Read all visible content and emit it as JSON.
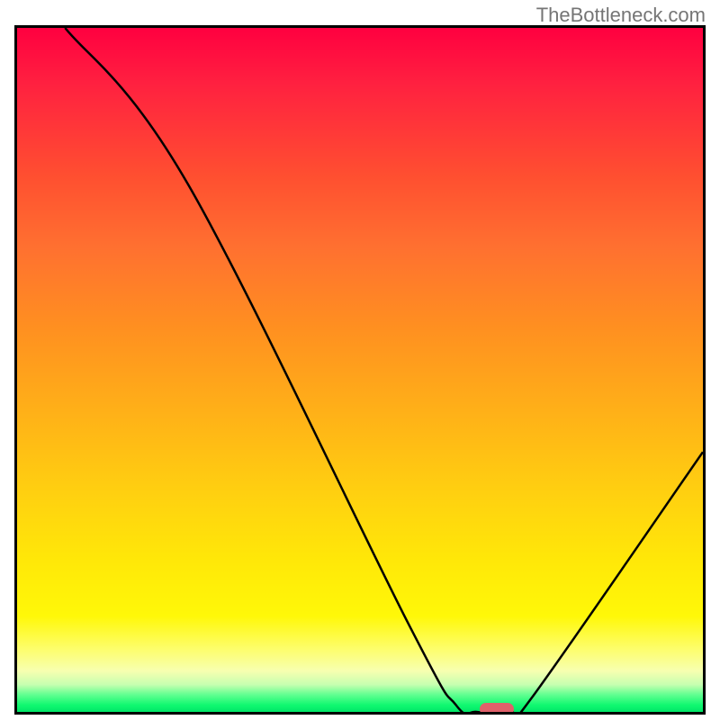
{
  "watermark": "TheBottleneck.com",
  "chart_data": {
    "type": "line",
    "title": "",
    "xlabel": "",
    "ylabel": "",
    "xlim": [
      0,
      100
    ],
    "ylim": [
      0,
      100
    ],
    "curve": [
      {
        "x": 7,
        "y": 100
      },
      {
        "x": 25,
        "y": 77
      },
      {
        "x": 57,
        "y": 13
      },
      {
        "x": 64,
        "y": 1
      },
      {
        "x": 67,
        "y": 0
      },
      {
        "x": 72,
        "y": 0
      },
      {
        "x": 75,
        "y": 2
      },
      {
        "x": 100,
        "y": 38
      }
    ],
    "background_gradient": {
      "stops": [
        {
          "pos": 0,
          "color": "#ff0040"
        },
        {
          "pos": 50,
          "color": "#ffb018"
        },
        {
          "pos": 88,
          "color": "#fff808"
        },
        {
          "pos": 100,
          "color": "#00e668"
        }
      ]
    },
    "marker": {
      "x": 70,
      "y": 0,
      "color": "#e0606a"
    }
  }
}
